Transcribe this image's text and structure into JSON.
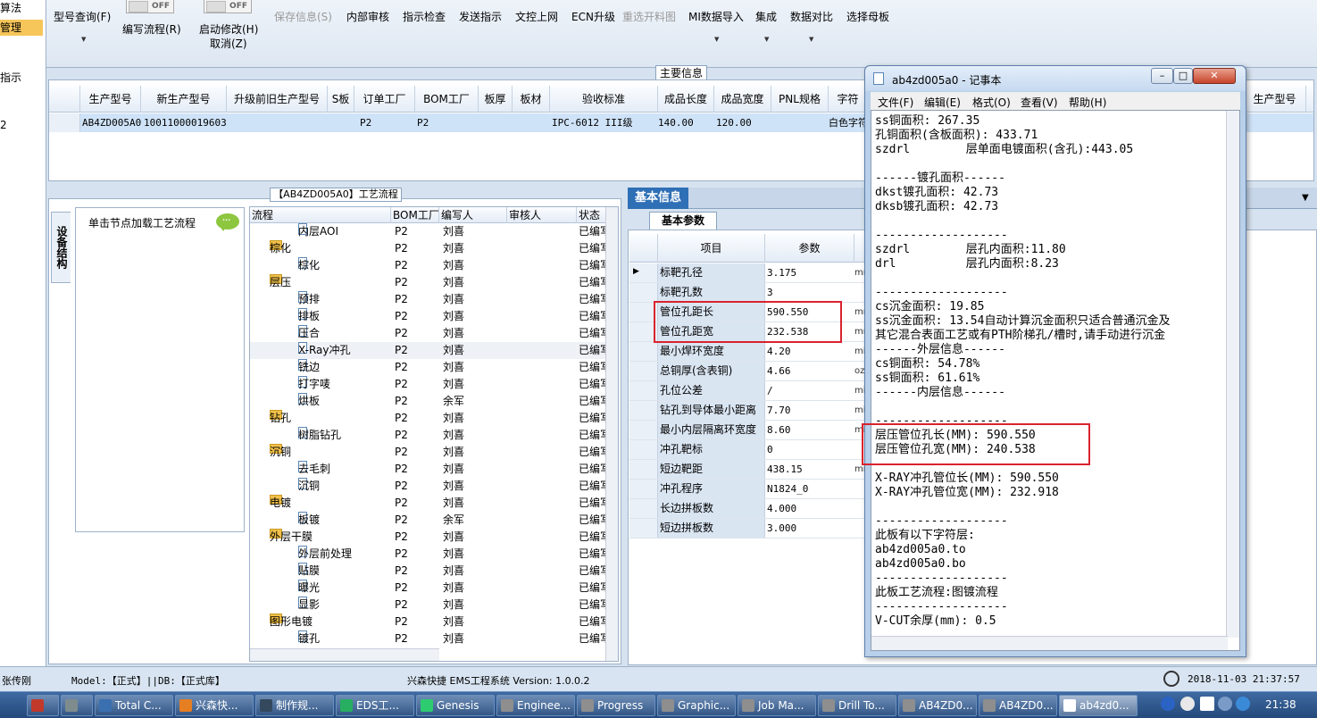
{
  "left_strip": {
    "items": [
      "算法",
      "管理",
      "指示",
      "2"
    ]
  },
  "toolbar": {
    "buttons": [
      {
        "label": "型号查询(F)",
        "disabled": false
      },
      {
        "label": "编写流程(R)",
        "disabled": false
      },
      {
        "label": "启动修改(H)",
        "disabled": false
      },
      {
        "label": "取消(Z)",
        "disabled": false
      },
      {
        "label": "保存信息(S)",
        "disabled": true
      },
      {
        "label": "内部审核",
        "disabled": false
      },
      {
        "label": "指示检查",
        "disabled": false
      },
      {
        "label": "发送指示",
        "disabled": false
      },
      {
        "label": "文控上网",
        "disabled": false
      },
      {
        "label": "ECN升级",
        "disabled": false
      },
      {
        "label": "重选开料图",
        "disabled": true
      },
      {
        "label": "MI数据导入",
        "disabled": false
      },
      {
        "label": "集成",
        "disabled": false
      },
      {
        "label": "数据对比",
        "disabled": false
      },
      {
        "label": "选择母板",
        "disabled": false
      }
    ],
    "toggle_label": "OFF",
    "dropdown_glyph": "▼"
  },
  "main_info": {
    "tab_label": "主要信息",
    "columns": [
      "生产型号",
      "新生产型号",
      "升级前旧生产型号",
      "S板",
      "订单工厂",
      "BOM工厂",
      "板厚",
      "板材",
      "验收标准",
      "成品长度",
      "成品宽度",
      "PNL规格",
      "字符",
      "生产型号"
    ],
    "row": [
      "AB4ZD005A0",
      "10011000019603",
      "",
      "",
      "P2",
      "P2",
      "",
      "",
      "IPC-6012 III级",
      "140.00",
      "120.00",
      "",
      "白色字符",
      ""
    ]
  },
  "process_panel": {
    "title": "【AB4ZD005A0】工艺流程",
    "vertical_tab": "设备结构",
    "node_hint": "单击节点加载工艺流程",
    "columns": [
      "流程",
      "BOM工厂",
      "编写人",
      "审核人",
      "状态"
    ],
    "rows": [
      {
        "name": "内层AOI",
        "level": 2,
        "type": "file",
        "bom": "P2",
        "writer": "刘喜",
        "status": "已编写"
      },
      {
        "name": "棕化",
        "level": 1,
        "type": "folder",
        "bom": "P2",
        "writer": "刘喜",
        "status": "已编写"
      },
      {
        "name": "棕化",
        "level": 2,
        "type": "file",
        "bom": "P2",
        "writer": "刘喜",
        "status": "已编写"
      },
      {
        "name": "层压",
        "level": 1,
        "type": "folder",
        "bom": "P2",
        "writer": "刘喜",
        "status": "已编写"
      },
      {
        "name": "预排",
        "level": 2,
        "type": "file",
        "bom": "P2",
        "writer": "刘喜",
        "status": "已编写"
      },
      {
        "name": "排板",
        "level": 2,
        "type": "file",
        "bom": "P2",
        "writer": "刘喜",
        "status": "已编写"
      },
      {
        "name": "压合",
        "level": 2,
        "type": "file",
        "bom": "P2",
        "writer": "刘喜",
        "status": "已编写"
      },
      {
        "name": "X-Ray冲孔",
        "level": 2,
        "type": "file",
        "bom": "P2",
        "writer": "刘喜",
        "status": "已编写",
        "selected": true
      },
      {
        "name": "铣边",
        "level": 2,
        "type": "file",
        "bom": "P2",
        "writer": "刘喜",
        "status": "已编写"
      },
      {
        "name": "打字唛",
        "level": 2,
        "type": "file",
        "bom": "P2",
        "writer": "刘喜",
        "status": "已编写"
      },
      {
        "name": "烘板",
        "level": 2,
        "type": "file",
        "bom": "P2",
        "writer": "余军",
        "status": "已编写"
      },
      {
        "name": "钻孔",
        "level": 1,
        "type": "folder",
        "bom": "P2",
        "writer": "刘喜",
        "status": "已编写"
      },
      {
        "name": "树脂钻孔",
        "level": 2,
        "type": "file",
        "bom": "P2",
        "writer": "刘喜",
        "status": "已编写"
      },
      {
        "name": "沉铜",
        "level": 1,
        "type": "folder",
        "bom": "P2",
        "writer": "刘喜",
        "status": "已编写"
      },
      {
        "name": "去毛刺",
        "level": 2,
        "type": "file",
        "bom": "P2",
        "writer": "刘喜",
        "status": "已编写"
      },
      {
        "name": "沉铜",
        "level": 2,
        "type": "file",
        "bom": "P2",
        "writer": "刘喜",
        "status": "已编写"
      },
      {
        "name": "电镀",
        "level": 1,
        "type": "folder",
        "bom": "P2",
        "writer": "刘喜",
        "status": "已编写"
      },
      {
        "name": "板镀",
        "level": 2,
        "type": "file",
        "bom": "P2",
        "writer": "余军",
        "status": "已编写"
      },
      {
        "name": "外层干膜",
        "level": 1,
        "type": "folder",
        "bom": "P2",
        "writer": "刘喜",
        "status": "已编写"
      },
      {
        "name": "外层前处理",
        "level": 2,
        "type": "file",
        "bom": "P2",
        "writer": "刘喜",
        "status": "已编写"
      },
      {
        "name": "贴膜",
        "level": 2,
        "type": "file",
        "bom": "P2",
        "writer": "刘喜",
        "status": "已编写"
      },
      {
        "name": "曝光",
        "level": 2,
        "type": "file",
        "bom": "P2",
        "writer": "刘喜",
        "status": "已编写"
      },
      {
        "name": "显影",
        "level": 2,
        "type": "file",
        "bom": "P2",
        "writer": "刘喜",
        "status": "已编写"
      },
      {
        "name": "图形电镀",
        "level": 1,
        "type": "folder",
        "bom": "P2",
        "writer": "刘喜",
        "status": "已编写"
      },
      {
        "name": "镀孔",
        "level": 2,
        "type": "file",
        "bom": "P2",
        "writer": "刘喜",
        "status": "已编写"
      }
    ]
  },
  "info_panel": {
    "tab_label": "基本信息",
    "sub_tab": "基本参数",
    "columns": [
      "项目",
      "参数"
    ],
    "rows": [
      {
        "key": "标靶孔径",
        "value": "3.175",
        "unit": "mm"
      },
      {
        "key": "标靶孔数",
        "value": "3",
        "unit": ""
      },
      {
        "key": "管位孔距长",
        "value": "590.550",
        "unit": "mm"
      },
      {
        "key": "管位孔距宽",
        "value": "232.538",
        "unit": "mm"
      },
      {
        "key": "最小焊环宽度",
        "value": "4.20",
        "unit": "mil"
      },
      {
        "key": "总铜厚(含表铜)",
        "value": "4.66",
        "unit": "oz"
      },
      {
        "key": "孔位公差",
        "value": "/",
        "unit": "mil"
      },
      {
        "key": "钻孔到导体最小距离",
        "value": "7.70",
        "unit": "mil"
      },
      {
        "key": "最小内层隔离环宽度",
        "value": "8.60",
        "unit": "mil"
      },
      {
        "key": "冲孔靶标",
        "value": "0",
        "unit": ""
      },
      {
        "key": "短边靶距",
        "value": "438.15",
        "unit": "mm"
      },
      {
        "key": "冲孔程序",
        "value": "N1824_0",
        "unit": ""
      },
      {
        "key": "长边拼板数",
        "value": "4.000",
        "unit": ""
      },
      {
        "key": "短边拼板数",
        "value": "3.000",
        "unit": ""
      }
    ]
  },
  "notepad": {
    "title": "ab4zd005a0 - 记事本",
    "menu": [
      "文件(F)",
      "编辑(E)",
      "格式(O)",
      "查看(V)",
      "帮助(H)"
    ],
    "text": "ss铜面积: 267.35\n孔铜面积(含板面积): 433.71\nszdrl        层单面电镀面积(含孔):443.05\n\n------镀孔面积------\ndkst镀孔面积: 42.73\ndksb镀孔面积: 42.73\n\n-------------------\nszdrl        层孔内面积:11.80\ndrl          层孔内面积:8.23\n\n-------------------\ncs沉金面积: 19.85\nss沉金面积: 13.54自动计算沉金面积只适合普通沉金及\n其它混合表面工艺或有PTH阶梯孔/槽时,请手动进行沉金\n------外层信息------\ncs铜面积: 54.78%\nss铜面积: 61.61%\n------内层信息------\n\n-------------------\n层压管位孔长(MM): 590.550\n层压管位孔宽(MM): 240.538\n\nX-RAY冲孔管位长(MM): 590.550\nX-RAY冲孔管位宽(MM): 232.918\n\n-------------------\n此板有以下字符层:\nab4zd005a0.to\nab4zd005a0.bo\n-------------------\n此板工艺流程:图镀流程\n-------------------\nV-CUT余厚(mm): 0.5"
  },
  "status_bar": {
    "user": "张传刚",
    "model": "Model:【正式】||DB:【正式库】",
    "system": "兴森快捷  EMS工程系统  Version: 1.0.0.2",
    "datetime": "2018-11-03 21:37:57"
  },
  "taskbar": {
    "items": [
      "",
      "",
      "Total C...",
      "兴森快...",
      "制作规...",
      "EDS工...",
      "Genesis",
      "Enginee...",
      "Progress",
      "Graphic...",
      "Job Ma...",
      "Drill To...",
      "AB4ZD0...",
      "AB4ZD0...",
      "ab4zd0..."
    ],
    "clock": "21:38"
  }
}
